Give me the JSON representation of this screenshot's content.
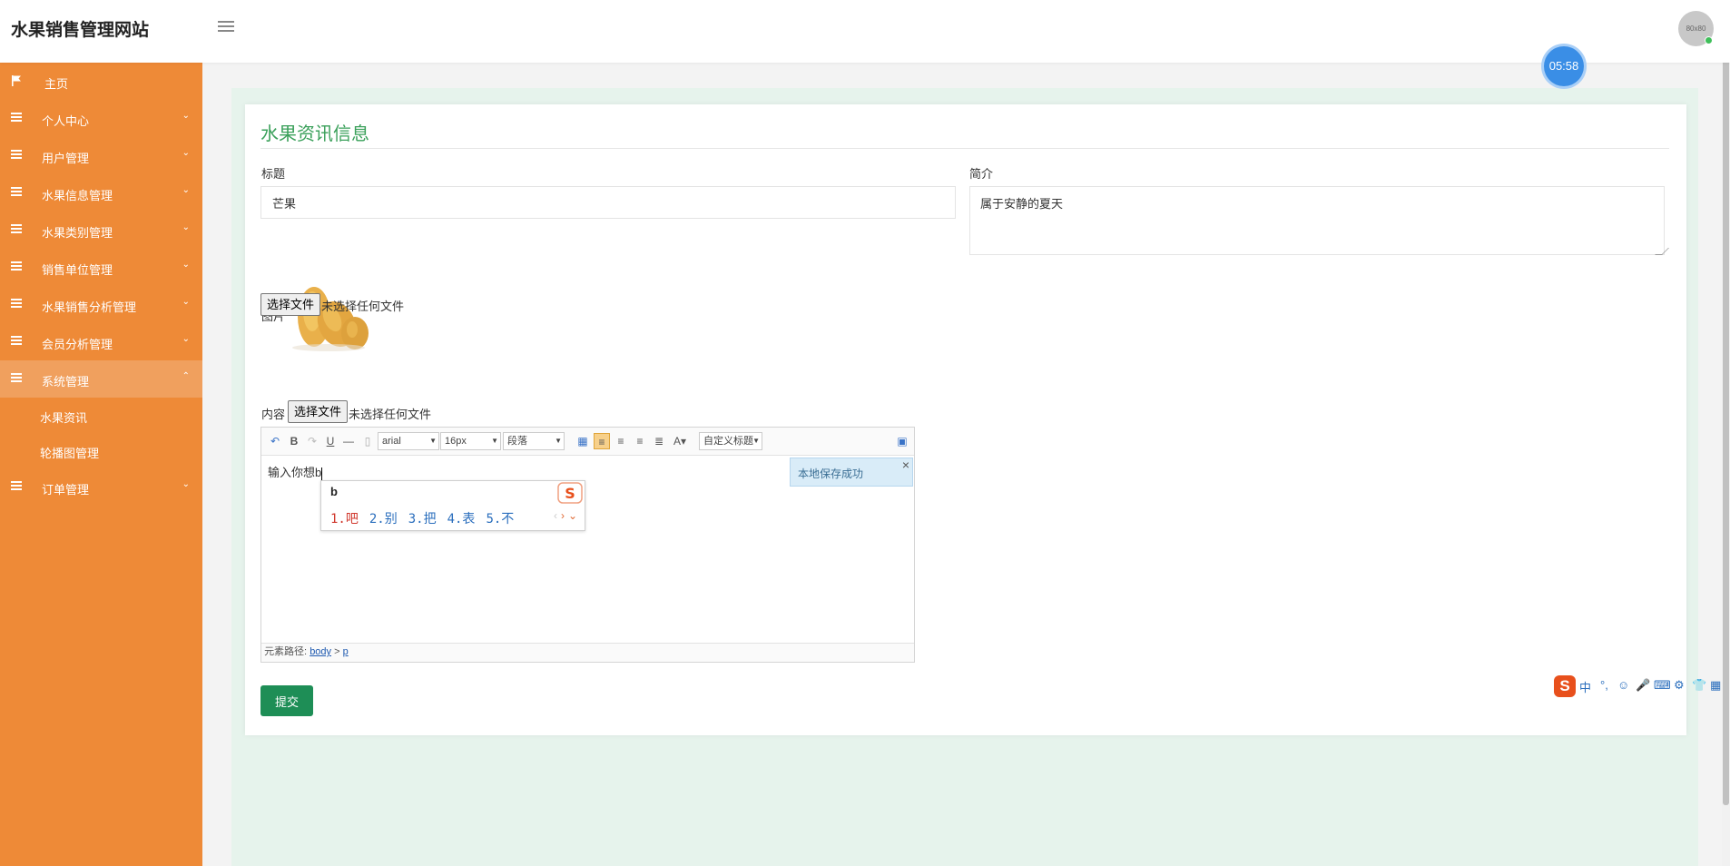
{
  "header": {
    "brand": "水果销售管理网站",
    "avatar_text": "80x80",
    "timer": "05:58"
  },
  "sidebar": {
    "items": [
      {
        "label": "主页",
        "icon": "flag-icon",
        "arrow": ""
      },
      {
        "label": "个人中心",
        "icon": "list-icon",
        "arrow": "⌄"
      },
      {
        "label": "用户管理",
        "icon": "list-icon",
        "arrow": "⌄"
      },
      {
        "label": "水果信息管理",
        "icon": "list-icon",
        "arrow": "⌄"
      },
      {
        "label": "水果类别管理",
        "icon": "list-icon",
        "arrow": "⌄"
      },
      {
        "label": "销售单位管理",
        "icon": "list-icon",
        "arrow": "⌄"
      },
      {
        "label": "水果销售分析管理",
        "icon": "list-icon",
        "arrow": "⌄"
      },
      {
        "label": "会员分析管理",
        "icon": "list-icon",
        "arrow": "⌄"
      },
      {
        "label": "系统管理",
        "icon": "list-icon",
        "arrow": "⌃",
        "expanded": true
      },
      {
        "label": "订单管理",
        "icon": "list-icon",
        "arrow": "⌄"
      }
    ],
    "submenu": [
      {
        "label": "水果资讯"
      },
      {
        "label": "轮播图管理"
      }
    ],
    "color": "#ee8a37"
  },
  "form": {
    "title": "水果资讯信息",
    "title_label": "标题",
    "title_value": "芒果",
    "intro_label": "简介",
    "intro_value": "属于安静的夏天",
    "picture_label": "图片",
    "file_button": "选择文件",
    "file_status": "未选择任何文件",
    "content_label": "内容",
    "content_file_button": "选择文件",
    "content_file_status": "未选择任何文件",
    "submit": "提交"
  },
  "editor": {
    "font": "arial",
    "size": "16px",
    "paragraph": "段落",
    "heading": "自定义标题",
    "body_text": "输入你想b",
    "toast": "本地保存成功",
    "toast_close": "×",
    "path_label": "元素路径:",
    "path_body": "body",
    "path_sep": ">",
    "path_p": "p"
  },
  "ime": {
    "pinyin": "b",
    "candidates": [
      "1.吧",
      "2.别",
      "3.把",
      "4.表",
      "5.不"
    ],
    "prev": "‹",
    "next": "›",
    "expand": "⌄"
  },
  "sogou_bar": {
    "logo": "S",
    "items": [
      "中",
      "°,",
      "☺",
      "🎤",
      "⌨",
      "⚙",
      "👕",
      "▦"
    ]
  },
  "colors": {
    "accent_green": "#3aa05a",
    "submit_green": "#1e8e56",
    "timer_blue": "#3a8ee6"
  }
}
